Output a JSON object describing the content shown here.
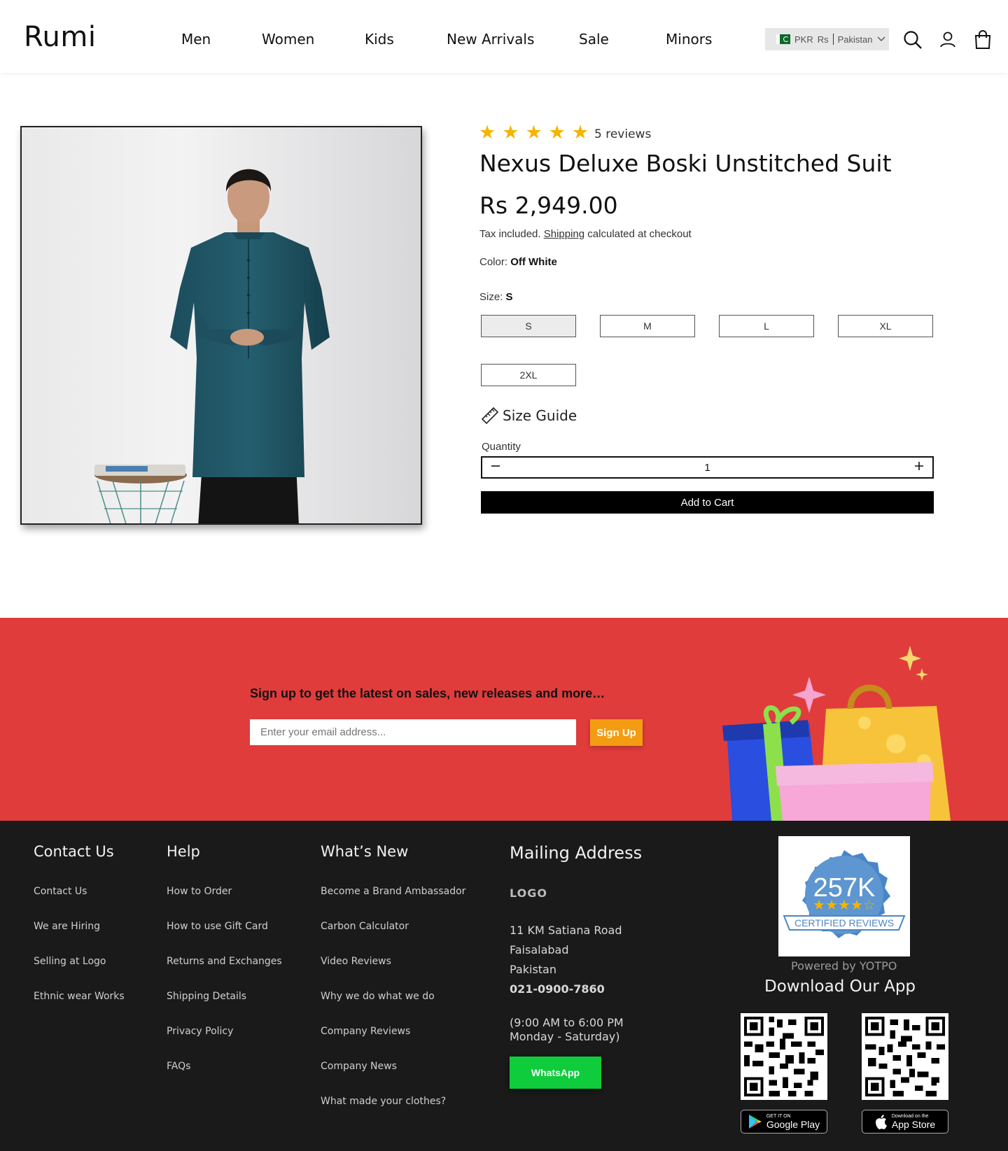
{
  "header": {
    "logo": "Rumi",
    "nav": [
      "Men",
      "Women",
      "Kids",
      "New Arrivals",
      "Sale",
      "Minors"
    ],
    "currency": {
      "code": "PKR",
      "symbol": "Rs",
      "country": "Pakistan"
    },
    "icons": [
      "search-icon",
      "account-icon",
      "cart-icon"
    ]
  },
  "product": {
    "rating": 5,
    "reviews_label": "5 reviews",
    "title": "Nexus Deluxe Boski Unstitched Suit",
    "price": "Rs 2,949.00",
    "tax_prefix": "Tax included.",
    "tax_link": "Shipping",
    "tax_suffix": "calculated at checkout",
    "color_label": "Color:",
    "color_value": "Off White",
    "size_label": "Size:",
    "size_value": "S",
    "sizes": [
      "S",
      "M",
      "L",
      "XL",
      "2XL"
    ],
    "selected_size": "S",
    "size_guide": "Size Guide",
    "quantity_label": "Quantity",
    "quantity": "1",
    "add_to_cart": "Add to Cart"
  },
  "newsletter": {
    "title": "Sign up to get the latest on sales, new releases and more…",
    "placeholder": "Enter your email address...",
    "button": "Sign Up"
  },
  "footer": {
    "contact": {
      "title": "Contact Us",
      "links": [
        "Contact Us",
        "We are Hiring",
        "Selling at Logo",
        "Ethnic wear Works"
      ]
    },
    "help": {
      "title": "Help",
      "links": [
        "How to Order",
        "How to use Gift Card",
        "Returns and Exchanges",
        "Shipping Details",
        "Privacy Policy",
        "FAQs"
      ]
    },
    "whats_new": {
      "title": "What’s New",
      "links": [
        "Become a Brand Ambassador",
        "Carbon Calculator",
        "Video Reviews",
        "Why we do what we do",
        "Company Reviews",
        "Company News",
        "What made your clothes?"
      ]
    },
    "mailing": {
      "title": "Mailing Address",
      "logo": "LOGO",
      "address": [
        "11 KM Satiana Road",
        "Faisalabad",
        "Pakistan"
      ],
      "phone": "021-0900-7860",
      "hours": [
        "(9:00 AM to 6:00 PM",
        "Monday - Saturday)"
      ],
      "whatsapp": "WhatsApp"
    },
    "badge": {
      "count": "257K",
      "label": "CERTIFIED REVIEWS",
      "powered": "Powered by YOTPO"
    },
    "app": {
      "title": "Download Our App",
      "google_small": "GET IT ON",
      "google": "Google Play",
      "apple_small": "Download on the",
      "apple": "App Store"
    }
  },
  "colors": {
    "accent": "#000000",
    "star": "#f4b400",
    "newsletter_bg": "#e03c3c",
    "footer_bg": "#1a1a1a",
    "signup": "#f39c12",
    "whatsapp": "#0ecc3c"
  }
}
